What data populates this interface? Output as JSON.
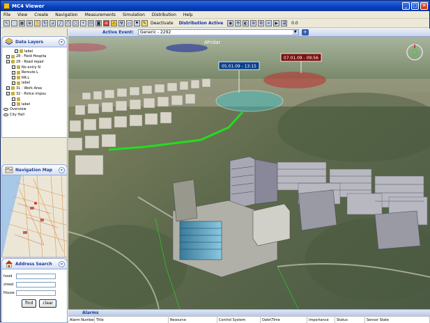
{
  "window": {
    "title": "MC4 Viewer",
    "min": "_",
    "max": "□",
    "close": "✕"
  },
  "menu": [
    "File",
    "View",
    "Create",
    "Navigation",
    "Measurements",
    "Simulation",
    "Distribution",
    "Help"
  ],
  "toolbar": {
    "deactivate_label": "Deactivate",
    "distribution_status": "Distribution Active",
    "zoom_value": "0.0"
  },
  "sidebar": {
    "layers": {
      "title": "Data Layers",
      "items": [
        {
          "label": "label",
          "checked": true
        },
        {
          "label": "28 - Field Hospita",
          "checked": true
        },
        {
          "label": "29 - Road repair",
          "checked": true
        },
        {
          "label": "No entry N",
          "checked": true
        },
        {
          "label": "Reroute L",
          "checked": true
        },
        {
          "label": "RR.L",
          "checked": true
        },
        {
          "label": "label",
          "checked": true
        },
        {
          "label": "31 - Work Area",
          "checked": true
        },
        {
          "label": "32 - Police impou",
          "checked": true
        },
        {
          "label": "",
          "checked": true
        },
        {
          "label": "label",
          "checked": true
        },
        {
          "label": "Overview",
          "checked": false
        },
        {
          "label": "City Hall",
          "checked": false
        }
      ]
    },
    "navmap": {
      "title": "Navigation Map"
    },
    "address": {
      "title": "Address Search",
      "fields": [
        {
          "label": "hood"
        },
        {
          "label": "street"
        },
        {
          "label": "House"
        }
      ],
      "find_label": "find",
      "clear_label": "clear"
    }
  },
  "main": {
    "event_label": "Active Event:",
    "event_value": "Generic - 2292",
    "map_label": "Afridar",
    "timestamps": [
      "05.01.09 - 13:15",
      "07.01.09 - 09:56"
    ]
  },
  "alarms": {
    "title": "Alarms",
    "columns": [
      "Alarm Number",
      "Title",
      "Resource",
      "Control System",
      "Date\\Time",
      "Importance",
      "Status",
      "Sensor State"
    ]
  },
  "colors": {
    "accent": "#1b3d99",
    "route": "#22dd22",
    "zone_cyan": "#3ec8d0",
    "zone_red": "#c03030"
  }
}
